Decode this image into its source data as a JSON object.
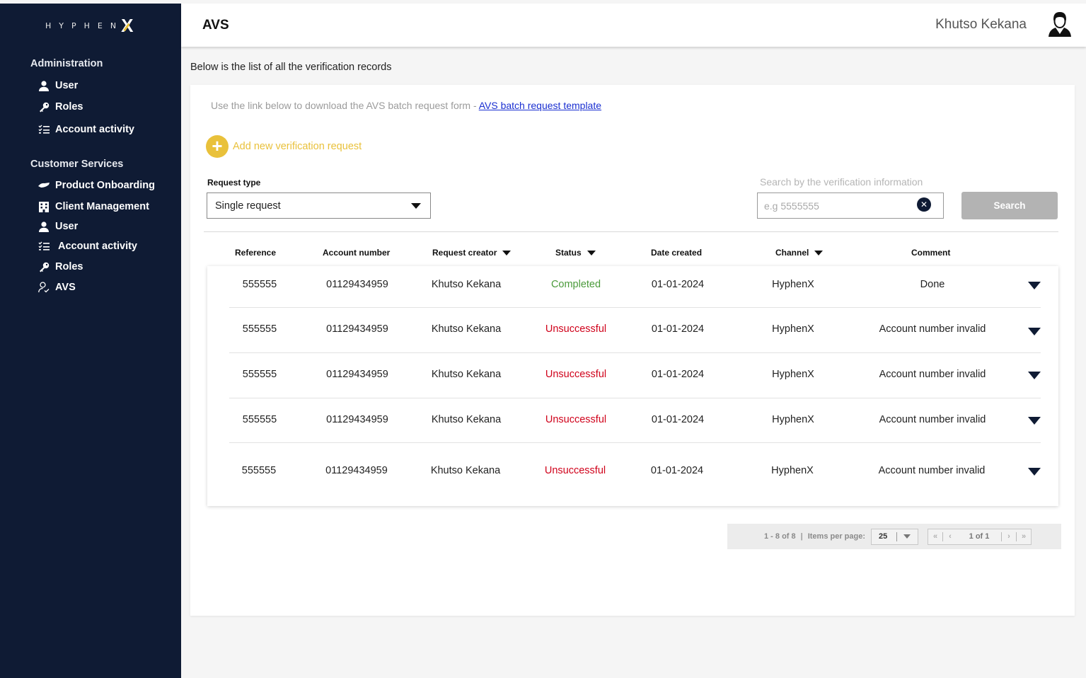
{
  "brand": {
    "logo_text": "HYPHEN",
    "logo_mark": "X"
  },
  "sidebar": {
    "sections": [
      {
        "title": "Administration",
        "items": [
          {
            "label": "User",
            "icon": "user-icon"
          },
          {
            "label": "Roles",
            "icon": "key-icon"
          },
          {
            "label": "Account activity",
            "icon": "checklist-icon"
          }
        ]
      },
      {
        "title": "Customer Services",
        "items": [
          {
            "label": "Product Onboarding",
            "icon": "handshake-icon"
          },
          {
            "label": "Client Management",
            "icon": "building-icon"
          },
          {
            "label": "User",
            "icon": "user-icon"
          },
          {
            "label": "Account activity",
            "icon": "checklist-icon"
          },
          {
            "label": "Roles",
            "icon": "key-icon"
          },
          {
            "label": "AVS",
            "icon": "user-check-icon"
          }
        ]
      }
    ]
  },
  "header": {
    "title": "AVS",
    "user_name": "Khutso Kekana"
  },
  "intro": "Below is the list of all the verification records",
  "download": {
    "text": "Use the link below to download the AVS batch request form - ",
    "link_label": "AVS batch request template"
  },
  "add_request_label": "Add new verification request",
  "filters": {
    "request_type_label": "Request type",
    "request_type_value": "Single request",
    "search_label": "Search by the verification information",
    "search_placeholder": "e.g 5555555",
    "search_button": "Search"
  },
  "table": {
    "columns": [
      "Reference",
      "Account number",
      "Request creator",
      "Status",
      "Date created",
      "Channel",
      "Comment"
    ],
    "rows": [
      {
        "reference": "555555",
        "account": "01129434959",
        "creator": "Khutso Kekana",
        "status": "Completed",
        "status_type": "ok",
        "date": "01-01-2024",
        "channel": "HyphenX",
        "comment": "Done"
      },
      {
        "reference": "555555",
        "account": "01129434959",
        "creator": "Khutso Kekana",
        "status": "Unsuccessful",
        "status_type": "bad",
        "date": "01-01-2024",
        "channel": "HyphenX",
        "comment": "Account number invalid"
      },
      {
        "reference": "555555",
        "account": "01129434959",
        "creator": "Khutso Kekana",
        "status": "Unsuccessful",
        "status_type": "bad",
        "date": "01-01-2024",
        "channel": "HyphenX",
        "comment": "Account number invalid"
      },
      {
        "reference": "555555",
        "account": "01129434959",
        "creator": "Khutso Kekana",
        "status": "Unsuccessful",
        "status_type": "bad",
        "date": "01-01-2024",
        "channel": "HyphenX",
        "comment": "Account number invalid"
      },
      {
        "reference": "555555",
        "account": "01129434959",
        "creator": "Khutso Kekana",
        "status": "Unsuccessful",
        "status_type": "bad",
        "date": "01-01-2024",
        "channel": "HyphenX",
        "comment": "Account number invalid"
      }
    ]
  },
  "paginator": {
    "range": "1 - 8 of 8",
    "items_per_page_label": "Items per page:",
    "items_per_page_value": "25",
    "page_label": "1 of 1"
  },
  "colors": {
    "sidebar_bg": "#0f1b34",
    "accent_yellow": "#e9c13b",
    "status_completed": "#4a9a3a",
    "status_unsuccessful": "#d0021b",
    "link_blue": "#1a2fd1"
  }
}
